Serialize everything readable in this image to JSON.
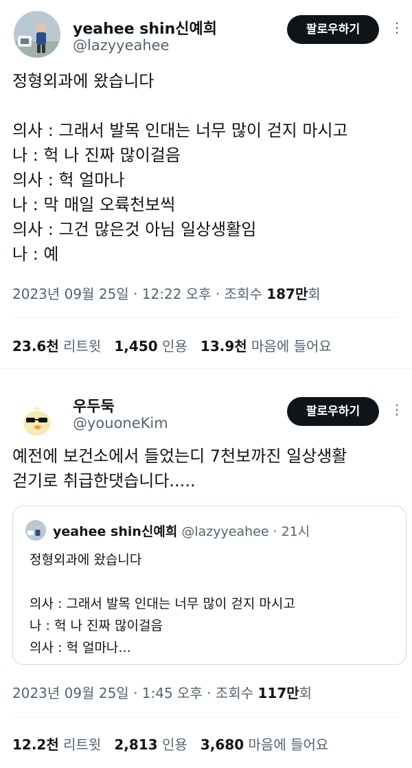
{
  "tweet1": {
    "name": "yeahee shin신예희",
    "handle": "@lazyyeahee",
    "follow_label": "팔로우하기",
    "more_label": "⋮",
    "text": "정형외과에 왔습니다\n\n의사 : 그래서 발목 인대는 너무 많이 걷지 마시고\n나 : 헉 나 진짜 많이걸음\n의사 : 헉 얼마나\n나 : 막 매일 오륙천보씩\n의사 : 그건 많은것 아님 일상생활임\n나 : 예",
    "meta_prefix": "2023년 09월 25일 · 12:22 오후 · 조회수 ",
    "views": "187만",
    "views_suffix": "회",
    "retweets": "23.6천",
    "retweets_label": "리트윗",
    "quotes": "1,450",
    "quotes_label": "인용",
    "likes": "13.9천",
    "likes_label": "마음에 들어요"
  },
  "tweet2": {
    "name": "우두둑",
    "handle": "@youoneKim",
    "follow_label": "팔로우하기",
    "more_label": "⋮",
    "text": "예전에 보건소에서 들었는디 7천보까진 일상생활\n걷기로 취급한댓습니다.....",
    "quote": {
      "name": "yeahee shin신예희",
      "handle": "@lazyyeahee · 21시",
      "text": "정형외과에 왔습니다\n\n의사 : 그래서 발목 인대는 너무 많이 걷지 마시고\n나 : 헉 나 진짜 많이걸음\n의사 : 헉 얼마나..."
    },
    "meta_prefix": "2023년 09월 25일 · 1:45 오후 · 조회수 ",
    "views": "117만",
    "views_suffix": "회",
    "retweets": "12.2천",
    "retweets_label": "리트윗",
    "quotes": "2,813",
    "quotes_label": "인용",
    "likes": "3,680",
    "likes_label": "마음에 들어요"
  }
}
